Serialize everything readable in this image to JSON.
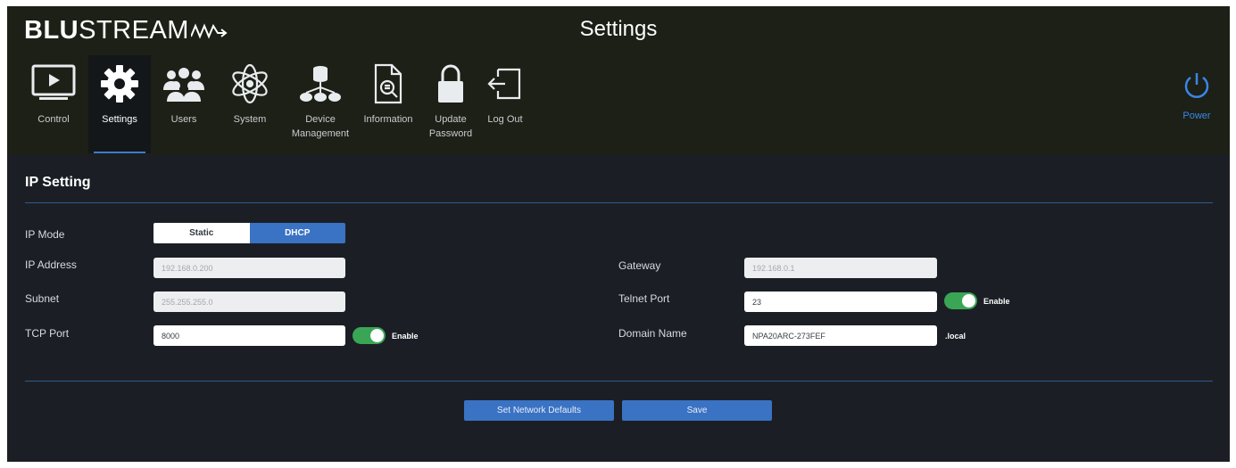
{
  "brand": {
    "bold": "BLU",
    "rest": "STREAM"
  },
  "page_title": "Settings",
  "colors": {
    "accent": "#3a72c4",
    "power": "#3b86e8",
    "toggle_on": "#3aa655"
  },
  "nav": {
    "items": [
      {
        "label": "Control",
        "icon": "play-screen-icon"
      },
      {
        "label": "Settings",
        "icon": "gear-icon",
        "active": true
      },
      {
        "label": "Users",
        "icon": "users-icon"
      },
      {
        "label": "System",
        "icon": "atom-icon"
      },
      {
        "label": "Device\nManagement",
        "icon": "device-tree-icon"
      },
      {
        "label": "Information",
        "icon": "document-search-icon"
      },
      {
        "label": "Update\nPassword",
        "icon": "lock-icon"
      },
      {
        "label": "Log Out",
        "icon": "logout-icon"
      }
    ],
    "power_label": "Power"
  },
  "ip_setting": {
    "title": "IP Setting",
    "ip_mode": {
      "label": "IP Mode",
      "options": [
        "Static",
        "DHCP"
      ],
      "selected": "DHCP"
    },
    "ip_address": {
      "label": "IP Address",
      "value": "192.168.0.200"
    },
    "subnet": {
      "label": "Subnet",
      "value": "255.255.255.0"
    },
    "tcp_port": {
      "label": "TCP Port",
      "value": "8000",
      "toggle_label": "Enable",
      "enabled": true
    },
    "gateway": {
      "label": "Gateway",
      "value": "192.168.0.1"
    },
    "telnet_port": {
      "label": "Telnet Port",
      "value": "23",
      "toggle_label": "Enable",
      "enabled": true
    },
    "domain_name": {
      "label": "Domain Name",
      "value": "NPA20ARC-273FEF",
      "suffix": ".local"
    }
  },
  "buttons": {
    "defaults": "Set Network Defaults",
    "save": "Save"
  }
}
